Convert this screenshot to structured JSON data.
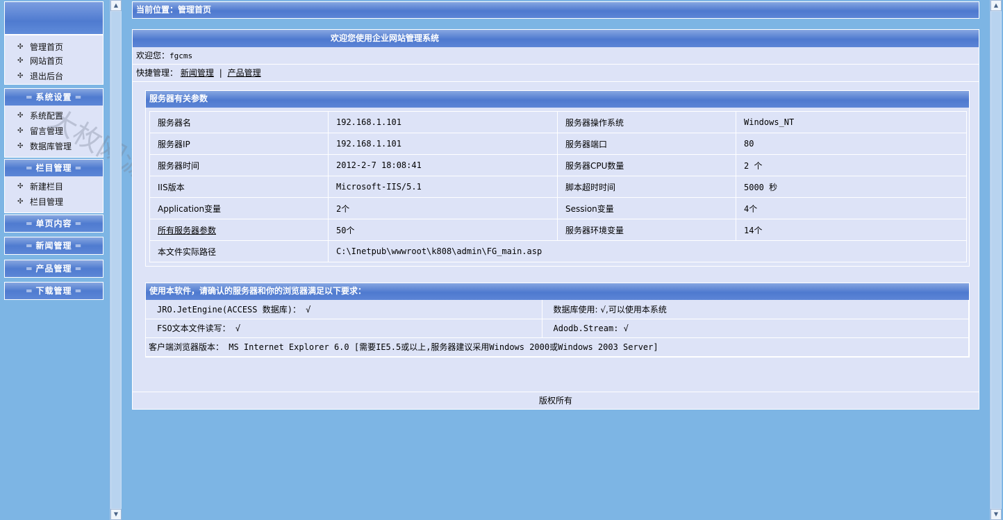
{
  "sidebar": {
    "top_items": [
      {
        "label": "管理首页"
      },
      {
        "label": "网站首页"
      },
      {
        "label": "退出后台"
      }
    ],
    "sections": [
      {
        "title": "系统设置",
        "items": [
          {
            "label": "系统配置"
          },
          {
            "label": "留言管理"
          },
          {
            "label": "数据库管理"
          }
        ]
      },
      {
        "title": "栏目管理",
        "items": [
          {
            "label": "新建栏目"
          },
          {
            "label": "栏目管理"
          }
        ]
      },
      {
        "title": "单页内容",
        "items": []
      },
      {
        "title": "新闻管理",
        "items": []
      },
      {
        "title": "产品管理",
        "items": []
      },
      {
        "title": "下载管理",
        "items": []
      }
    ],
    "deco": "═"
  },
  "breadcrumb": "当前位置：管理首页",
  "main": {
    "title": "欢迎您使用企业网站管理系统",
    "welcome_label": "欢迎您：",
    "username": "fgcms",
    "quick_label": "快捷管理：",
    "quick_links": [
      "新闻管理",
      "产品管理"
    ],
    "quick_sep": "|"
  },
  "server": {
    "title": "服务器有关参数",
    "rows": [
      [
        "服务器名",
        "192.168.1.101",
        "服务器操作系统",
        "Windows_NT"
      ],
      [
        "服务器IP",
        "192.168.1.101",
        "服务器端口",
        "80"
      ],
      [
        "服务器时间",
        "2012-2-7 18:08:41",
        "服务器CPU数量",
        "2 个"
      ],
      [
        "IIS版本",
        "Microsoft-IIS/5.1",
        "脚本超时时间",
        "5000 秒"
      ],
      [
        "Application变量",
        " 2个",
        "Session变量",
        "4个"
      ],
      [
        "所有服务器参数",
        " 50个",
        "服务器环境变量",
        "14个"
      ]
    ],
    "path_label": "本文件实际路径",
    "path_value": "C:\\Inetpub\\wwwroot\\k808\\admin\\FG_main.asp"
  },
  "requirements": {
    "title": "使用本软件，请确认的服务器和你的浏览器满足以下要求：",
    "jro": "JRO.JetEngine(ACCESS  数据库)： √",
    "db": "数据库使用: √,可以使用本系统",
    "fso": "FSO文本文件读写： √",
    "adodb": "Adodb.Stream: √",
    "browser": "客户端浏览器版本： MS Internet Explorer 6.0 [需要IE5.5或以上,服务器建议采用Windows 2000或Windows 2003 Server]"
  },
  "footer": "版权所有",
  "watermark": "大枚网源码"
}
